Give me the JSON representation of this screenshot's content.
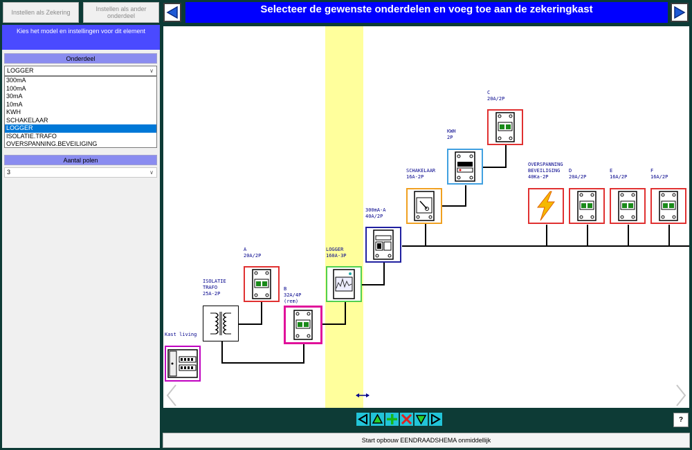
{
  "top_buttons": {
    "set_as_fuse": "Instellen als Zekering",
    "set_as_other": "Instellen als ander onderdeel"
  },
  "panel": {
    "header": "Kies het model en instellingen voor dit element",
    "part_section": "Onderdeel",
    "part_selected": "LOGGER",
    "part_options": [
      "300mA",
      "100mA",
      "30mA",
      "10mA",
      "KWH",
      "SCHAKELAAR",
      "LOGGER",
      "ISOLATIE.TRAFO",
      "OVERSPANNING.BEVEILIGING"
    ],
    "poles_section": "Aantal polen",
    "poles_selected": "3"
  },
  "title": "Selecteer de gewenste onderdelen en voeg toe aan de zekeringkast",
  "diagram": {
    "kast": "Kast living",
    "trafo": "ISOLATIE\nTRAFO\n25A-2P",
    "a": "A\n20A/2P",
    "b": "B\n32A/4P\n(rem)",
    "logger": "LOGGER\n160A-3P",
    "rcd": "300mA-A\n40A/2P",
    "switch": "SCHAKELAAR\n16A-2P",
    "kwh": "KWH\n2P",
    "c": "C\n20A/2P",
    "surge": "OVERSPANNING\nBEVEILIGING\n40Ka-2P",
    "d": "D\n20A/2P",
    "e": "E\n16A/2P",
    "f": "F\n16A/2P"
  },
  "colors": {
    "title_bg": "#0000ff",
    "panel_header": "#4a4aff",
    "section_header": "#8a8cf0",
    "highlight": "#ffff9c",
    "dark_bg": "#0d3b36"
  },
  "toolbar_icons": [
    "arrow-left-icon",
    "arrow-up-icon",
    "plus-icon",
    "delete-icon",
    "arrow-down-icon",
    "arrow-right-icon"
  ],
  "help_label": "?",
  "start_label": "Start opbouw EENDRAADSHEMA onmiddellijk"
}
